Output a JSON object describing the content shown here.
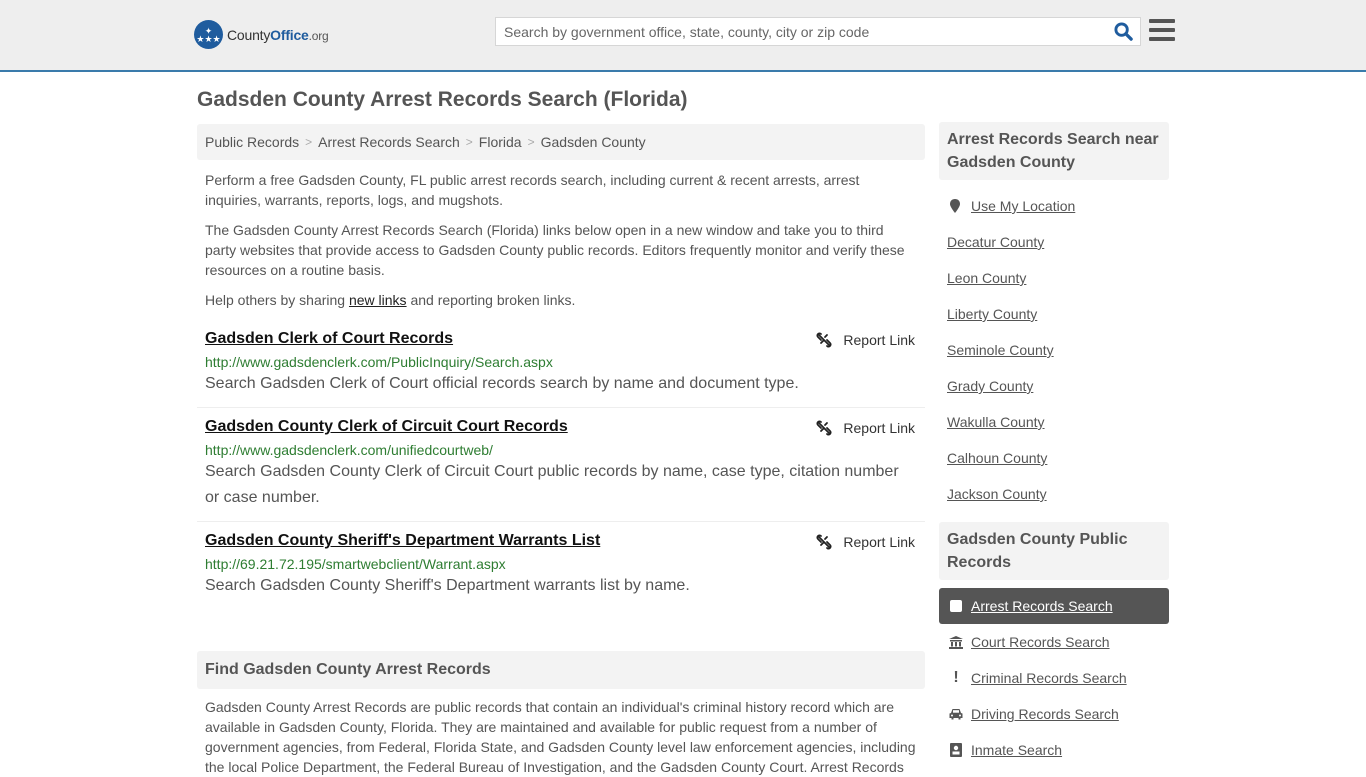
{
  "header": {
    "logo": {
      "county": "County",
      "office": "Office",
      "tld": ".org"
    },
    "search_placeholder": "Search by government office, state, county, city or zip code",
    "search_value": ""
  },
  "page_title": "Gadsden County Arrest Records Search (Florida)",
  "breadcrumb": [
    "Public Records",
    "Arrest Records Search",
    "Florida",
    "Gadsden County"
  ],
  "intro": {
    "p1": "Perform a free Gadsden County, FL public arrest records search, including current & recent arrests, arrest inquiries, warrants, reports, logs, and mugshots.",
    "p2": "The Gadsden County Arrest Records Search (Florida) links below open in a new window and take you to third party websites that provide access to Gadsden County public records. Editors frequently monitor and verify these resources on a routine basis.",
    "p3_before": "Help others by sharing ",
    "p3_link": "new links",
    "p3_after": " and reporting broken links."
  },
  "results": [
    {
      "title": "Gadsden Clerk of Court Records",
      "url": "http://www.gadsdenclerk.com/PublicInquiry/Search.aspx",
      "description": "Search Gadsden Clerk of Court official records search by name and document type.",
      "report_label": "Report Link"
    },
    {
      "title": "Gadsden County Clerk of Circuit Court Records",
      "url": "http://www.gadsdenclerk.com/unifiedcourtweb/",
      "description": "Search Gadsden County Clerk of Circuit Court public records by name, case type, citation number or case number.",
      "report_label": "Report Link"
    },
    {
      "title": "Gadsden County Sheriff's Department Warrants List",
      "url": "http://69.21.72.195/smartwebclient/Warrant.aspx",
      "description": "Search Gadsden County Sheriff's Department warrants list by name.",
      "report_label": "Report Link"
    }
  ],
  "find_section": {
    "heading": "Find Gadsden County Arrest Records",
    "body": "Gadsden County Arrest Records are public records that contain an individual's criminal history record which are available in Gadsden County, Florida. They are maintained and available for public request from a number of government agencies, from Federal, Florida State, and Gadsden County level law enforcement agencies, including the local Police Department, the Federal Bureau of Investigation, and the Gadsden County Court. Arrest Records"
  },
  "sidebar": {
    "nearby_heading": "Arrest Records Search near Gadsden County",
    "use_location": "Use My Location",
    "nearby": [
      "Decatur County",
      "Leon County",
      "Liberty County",
      "Seminole County",
      "Grady County",
      "Wakulla County",
      "Calhoun County",
      "Jackson County"
    ],
    "public_heading": "Gadsden County Public Records",
    "public_records": [
      {
        "label": "Arrest Records Search",
        "icon": "square-icon",
        "active": true
      },
      {
        "label": "Court Records Search",
        "icon": "courthouse-icon",
        "active": false
      },
      {
        "label": "Criminal Records Search",
        "icon": "exclamation-icon",
        "active": false
      },
      {
        "label": "Driving Records Search",
        "icon": "car-icon",
        "active": false
      },
      {
        "label": "Inmate Search",
        "icon": "inmate-icon",
        "active": false
      }
    ]
  },
  "colors": {
    "brand": "#1f5c9e",
    "header_border": "#3a7bab",
    "url_green": "#2e7d32",
    "active_bg": "#555555"
  }
}
